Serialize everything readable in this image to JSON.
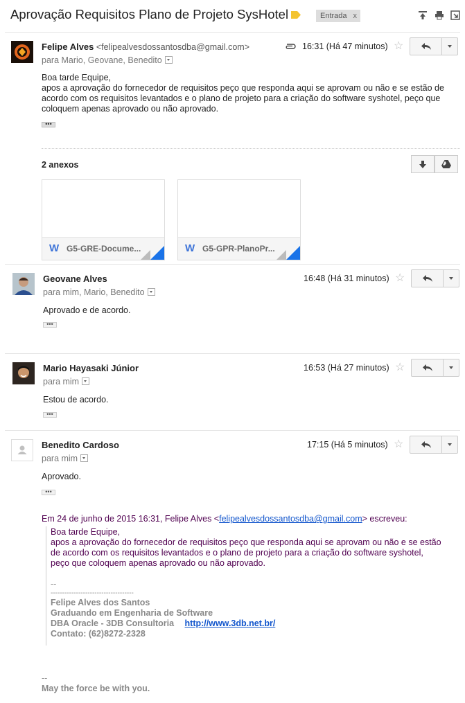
{
  "subject": "Aprovação Requisitos Plano de Projeto SysHotel",
  "inbox_label": "Entrada",
  "inbox_label_remove": "x",
  "messages": [
    {
      "sender": "Felipe Alves",
      "sender_email": "<felipealvesdossantosdba@gmail.com>",
      "recipients": "para Mario, Geovane, Benedito",
      "time": "16:31 (Há 47 minutos)",
      "body": [
        "Boa tarde Equipe,",
        "apos a aprovação do fornecedor de requisitos peço que responda aqui se aprovam ou não e se estão de acordo com os requisitos levantados e o plano de projeto para a criação do software syshotel, peço que coloquem apenas aprovado ou não aprovado."
      ],
      "attachments_title": "2 anexos",
      "attachments": [
        {
          "icon": "W",
          "name": "G5-GRE-Docume..."
        },
        {
          "icon": "W",
          "name": "G5-GPR-PlanoPr..."
        }
      ]
    },
    {
      "sender": "Geovane Alves",
      "recipients": "para mim, Mario, Benedito",
      "time": "16:48 (Há 31 minutos)",
      "body": [
        "Aprovado e de acordo."
      ]
    },
    {
      "sender": "Mario Hayasaki Júnior",
      "recipients": "para mim",
      "time": "16:53 (Há 27 minutos)",
      "body": [
        "Estou de acordo."
      ]
    },
    {
      "sender": "Benedito Cardoso",
      "recipients": "para mim",
      "time": "17:15 (Há 5 minutos)",
      "body": [
        "Aprovado."
      ],
      "quote_header_prefix": "Em 24 de junho de 2015 16:31, Felipe Alves <",
      "quote_header_email": "felipealvesdossantosdba@gmail.com",
      "quote_header_suffix": "> escreveu:",
      "quote_lines": [
        "Boa tarde Equipe,",
        "apos a aprovação do fornecedor de requisitos peço que responda aqui se aprovam ou não e se estão",
        "de acordo com os requisitos levantados e o plano de projeto para a criação do software syshotel,",
        "peço que coloquem apenas aprovado ou não aprovado."
      ],
      "quote_sig_dash": "--",
      "quote_sig_rule": "------------------------------------",
      "quote_sig_name": "Felipe Alves dos Santos",
      "quote_sig_role": "Graduando em Engenharia de Software",
      "quote_sig_company": "DBA Oracle - 3DB Consultoria",
      "quote_sig_url": "http://www.3db.net.br/",
      "quote_sig_contact": "Contato: (62)8272-2328",
      "sig_dash": "--",
      "sig_text": "May the force be with you."
    }
  ],
  "ellipsis": "•••",
  "colors": {
    "link": "#1155cc",
    "quote": "#500050",
    "label_tag": "#f4c430",
    "attachment_corner": "#1a73e8"
  }
}
